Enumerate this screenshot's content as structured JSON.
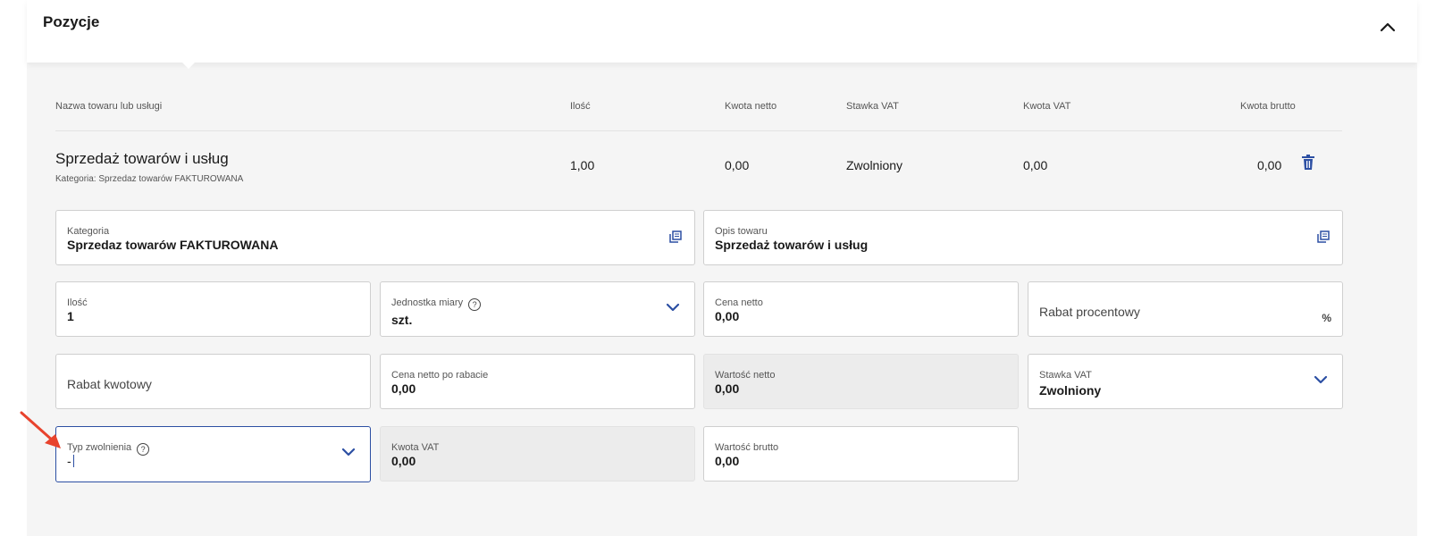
{
  "section": {
    "title": "Pozycje"
  },
  "table": {
    "headers": {
      "name": "Nazwa towaru lub usługi",
      "qty": "Ilość",
      "net": "Kwota netto",
      "vat_rate": "Stawka VAT",
      "vat_amount": "Kwota VAT",
      "gross": "Kwota brutto"
    },
    "row": {
      "name": "Sprzedaż towarów i usług",
      "category": "Kategoria: Sprzedaz towarów FAKTUROWANA",
      "qty": "1,00",
      "net": "0,00",
      "vat_rate": "Zwolniony",
      "vat_amount": "0,00",
      "gross": "0,00"
    }
  },
  "form": {
    "kategoria": {
      "label": "Kategoria",
      "value": "Sprzedaz towarów FAKTUROWANA"
    },
    "opis": {
      "label": "Opis towaru",
      "value": "Sprzedaż towarów i usług"
    },
    "ilosc": {
      "label": "Ilość",
      "value": "1"
    },
    "jednostka": {
      "label": "Jednostka miary",
      "value": "szt."
    },
    "cena_netto": {
      "label": "Cena netto",
      "value": "0,00"
    },
    "rabat_procentowy": {
      "placeholder": "Rabat procentowy",
      "suffix": "%"
    },
    "rabat_kwotowy": {
      "placeholder": "Rabat kwotowy"
    },
    "cena_po_rabacie": {
      "label": "Cena netto po rabacie",
      "value": "0,00"
    },
    "wartosc_netto": {
      "label": "Wartość netto",
      "value": "0,00"
    },
    "stawka_vat": {
      "label": "Stawka VAT",
      "value": "Zwolniony"
    },
    "typ_zwolnienia": {
      "label": "Typ zwolnienia",
      "value": "-"
    },
    "kwota_vat": {
      "label": "Kwota VAT",
      "value": "0,00"
    },
    "wartosc_brutto": {
      "label": "Wartość brutto",
      "value": "0,00"
    }
  },
  "icons": {
    "collapse": "chevron-up-icon",
    "delete": "trash-icon",
    "copy": "copy-icon",
    "dropdown": "chevron-down-icon",
    "info": "info-icon",
    "annotation": "red-arrow-icon"
  },
  "colors": {
    "accent": "#2c4fa3",
    "annotation": "#e8432d",
    "panel_bg": "#f5f5f5"
  }
}
